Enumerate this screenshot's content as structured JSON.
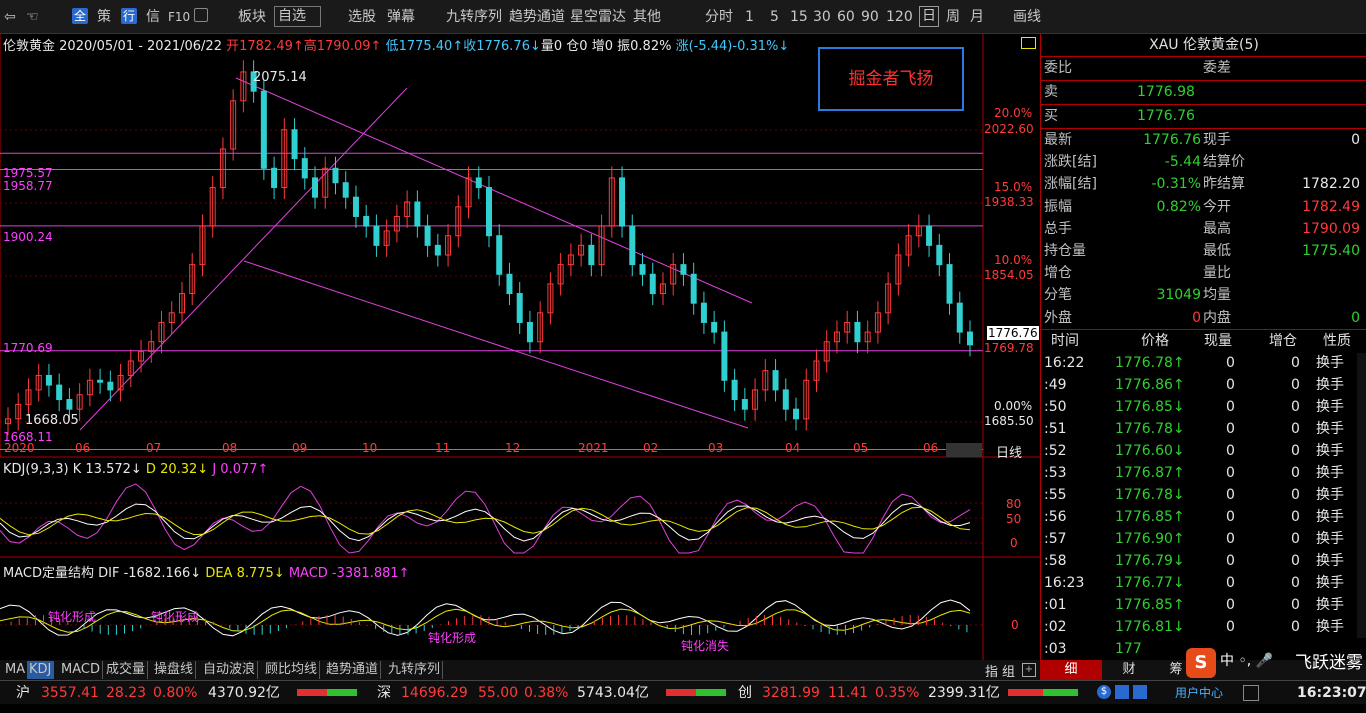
{
  "toolbar": {
    "items": [
      "全",
      "策",
      "行",
      "信",
      "F10",
      "板块",
      "自选",
      "选股",
      "弹幕",
      "九转序列",
      "趋势通道",
      "星空雷达",
      "其他",
      "分时",
      "1",
      "5",
      "15",
      "30",
      "60",
      "90",
      "120",
      "日",
      "周",
      "月",
      "画线"
    ]
  },
  "chart": {
    "symbol": "伦敦黄金",
    "range": "2020/05/01 - 2021/06/22",
    "open": "开1782.49↑",
    "high": "高1790.09↑",
    "low": "低1775.40↑",
    "close": "收1776.76↓",
    "vol": "量0",
    "oi": "仓0",
    "inc": "增0",
    "amp": "振0.82%",
    "chg": "涨(-5.44)-0.31%↓",
    "watermark": "掘金者飞扬",
    "peak_label": "2075.14",
    "low_label": "1668.05",
    "hlines": [
      "1975.57",
      "1958.77",
      "1900.24",
      "1770.69",
      "1668.11"
    ],
    "axis_prices": [
      "2022.60",
      "1938.33",
      "1854.05",
      "1769.78",
      "1685.50"
    ],
    "axis_pcts": [
      "20.0%",
      "15.0%",
      "10.0%",
      "0.00%"
    ],
    "last_price": "1776.76",
    "period": "日线",
    "months": [
      "2020",
      "06",
      "07",
      "08",
      "09",
      "10",
      "11",
      "12",
      "2021",
      "02",
      "03",
      "04",
      "05",
      "06"
    ]
  },
  "chart_data": {
    "type": "candlestick",
    "title": "伦敦黄金",
    "x_range": [
      "2020/05/01",
      "2021/06/22"
    ],
    "ylim": [
      1650,
      2090
    ],
    "closes": [
      1700,
      1715,
      1730,
      1745,
      1735,
      1720,
      1710,
      1725,
      1740,
      1738,
      1730,
      1745,
      1760,
      1770,
      1780,
      1800,
      1810,
      1830,
      1860,
      1900,
      1940,
      1980,
      2030,
      2060,
      2040,
      1960,
      1940,
      2000,
      1970,
      1950,
      1930,
      1960,
      1945,
      1930,
      1910,
      1900,
      1880,
      1895,
      1910,
      1925,
      1900,
      1880,
      1870,
      1890,
      1920,
      1950,
      1940,
      1890,
      1850,
      1830,
      1800,
      1780,
      1810,
      1840,
      1860,
      1870,
      1880,
      1860,
      1900,
      1950,
      1900,
      1860,
      1850,
      1830,
      1840,
      1860,
      1850,
      1820,
      1800,
      1790,
      1740,
      1720,
      1710,
      1730,
      1750,
      1730,
      1710,
      1700,
      1740,
      1760,
      1780,
      1790,
      1800,
      1780,
      1790,
      1810,
      1840,
      1870,
      1890,
      1900,
      1880,
      1860,
      1820,
      1790,
      1776.76
    ]
  },
  "kdj": {
    "label": "KDJ(9,3,3)",
    "k": "K 13.572↓",
    "d": "D 20.32↓",
    "j": "J 0.077↑",
    "levels": [
      "80",
      "50",
      "0"
    ]
  },
  "macd": {
    "label": "MACD定量结构",
    "dif": "DIF -1682.166↓",
    "dea": "DEA 8.775↓",
    "macd": "MACD -3381.881↑",
    "zero": "0",
    "tags": [
      "钝化形成",
      "钝化形成",
      "钝化形成",
      "钝化消失"
    ]
  },
  "tabs": [
    "MA",
    "KDJ",
    "MACD",
    "成交量",
    "操盘线",
    "自动波浪",
    "顾比均线",
    "趋势通道",
    "九转序列"
  ],
  "tabs_right": [
    "指",
    "组"
  ],
  "panel": {
    "title": "XAU 伦敦黄金(5)",
    "wb_label": "委比",
    "wc_label": "委差",
    "sell_label": "卖",
    "sell": "1776.98",
    "buy_label": "买",
    "buy": "1776.76",
    "rows": [
      {
        "l1": "最新",
        "v1": "1776.76",
        "l2": "现手",
        "v2": "0"
      },
      {
        "l1": "涨跌[结]",
        "v1": "-5.44",
        "l2": "结算价",
        "v2": ""
      },
      {
        "l1": "涨幅[结]",
        "v1": "-0.31%",
        "l2": "昨结算",
        "v2": "1782.20"
      },
      {
        "l1": "振幅",
        "v1": "0.82%",
        "l2": "今开",
        "v2": "1782.49"
      },
      {
        "l1": "总手",
        "v1": "",
        "l2": "最高",
        "v2": "1790.09"
      },
      {
        "l1": "持仓量",
        "v1": "",
        "l2": "最低",
        "v2": "1775.40"
      },
      {
        "l1": "增仓",
        "v1": "",
        "l2": "量比",
        "v2": ""
      },
      {
        "l1": "分笔",
        "v1": "31049",
        "l2": "均量",
        "v2": ""
      },
      {
        "l1": "外盘",
        "v1": "0",
        "l2": "内盘",
        "v2": "0"
      }
    ],
    "tick_headers": [
      "时间",
      "价格",
      "现量",
      "增仓",
      "性质"
    ],
    "ticks": [
      {
        "t": "16:22",
        "p": "1776.78↑",
        "q": "0",
        "z": "0",
        "n": "换手"
      },
      {
        "t": ":49",
        "p": "1776.86↑",
        "q": "0",
        "z": "0",
        "n": "换手"
      },
      {
        "t": ":50",
        "p": "1776.85↓",
        "q": "0",
        "z": "0",
        "n": "换手"
      },
      {
        "t": ":51",
        "p": "1776.78↓",
        "q": "0",
        "z": "0",
        "n": "换手"
      },
      {
        "t": ":52",
        "p": "1776.60↓",
        "q": "0",
        "z": "0",
        "n": "换手"
      },
      {
        "t": ":53",
        "p": "1776.87↑",
        "q": "0",
        "z": "0",
        "n": "换手"
      },
      {
        "t": ":55",
        "p": "1776.78↓",
        "q": "0",
        "z": "0",
        "n": "换手"
      },
      {
        "t": ":56",
        "p": "1776.85↑",
        "q": "0",
        "z": "0",
        "n": "换手"
      },
      {
        "t": ":57",
        "p": "1776.90↑",
        "q": "0",
        "z": "0",
        "n": "换手"
      },
      {
        "t": ":58",
        "p": "1776.79↓",
        "q": "0",
        "z": "0",
        "n": "换手"
      },
      {
        "t": "16:23",
        "p": "1776.77↓",
        "q": "0",
        "z": "0",
        "n": "换手"
      },
      {
        "t": ":01",
        "p": "1776.85↑",
        "q": "0",
        "z": "0",
        "n": "换手"
      },
      {
        "t": ":02",
        "p": "1776.81↓",
        "q": "0",
        "z": "0",
        "n": "换手"
      },
      {
        "t": ":03",
        "p": "177",
        "q": "",
        "z": "",
        "n": ""
      }
    ],
    "bottom_tabs": [
      "细",
      "财",
      "筹"
    ]
  },
  "status": {
    "sh_label": "沪",
    "sh": "3557.41",
    "sh_chg": "28.23",
    "sh_pct": "0.80%",
    "sh_amt": "4370.92亿",
    "sz_label": "深",
    "sz": "14696.29",
    "sz_chg": "55.00",
    "sz_pct": "0.38%",
    "sz_amt": "5743.04亿",
    "cy_label": "创",
    "cy": "3281.99",
    "cy_chg": "11.41",
    "cy_pct": "0.35%",
    "cy_amt": "2399.31亿",
    "user": "用户中心",
    "time": "16:23:07"
  },
  "overlay": {
    "weibo": "飞跃迷雾"
  },
  "colors": {
    "up": "#ff3a3a",
    "down": "#30d0d0",
    "line": "#e040e0",
    "bg": "#000000"
  }
}
